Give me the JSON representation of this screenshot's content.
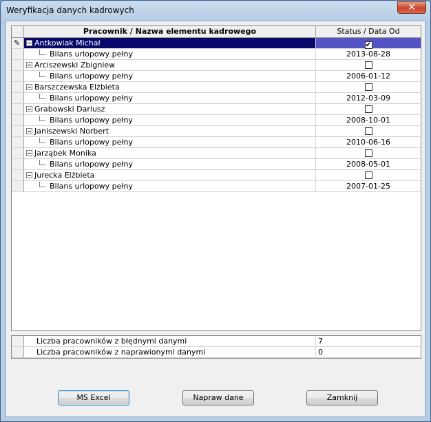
{
  "window": {
    "title": "Weryfikacja danych kadrowych",
    "close_glyph": "✕"
  },
  "grid": {
    "columns": [
      "Pracownik / Nazwa elementu kadrowego",
      "Status / Data Od"
    ],
    "rows": [
      {
        "employee": "Antkowiak Michał",
        "checked": true,
        "selected": true,
        "item": "Bilans urlopowy pełny",
        "date": "2013-08-28"
      },
      {
        "employee": "Arciszewski Zbigniew",
        "checked": false,
        "item": "Bilans urlopowy pełny",
        "date": "2006-01-12"
      },
      {
        "employee": "Barszczewska Elżbieta",
        "checked": false,
        "item": "Bilans urlopowy pełny",
        "date": "2012-03-09"
      },
      {
        "employee": "Grabowski Dariusz",
        "checked": false,
        "item": "Bilans urlopowy pełny",
        "date": "2008-10-01"
      },
      {
        "employee": "Janiszewski Norbert",
        "checked": false,
        "item": "Bilans urlopowy pełny",
        "date": "2010-06-16"
      },
      {
        "employee": "Jarząbek Monika",
        "checked": false,
        "item": "Bilans urlopowy pełny",
        "date": "2008-05-01"
      },
      {
        "employee": "Jurecka Elżbieta",
        "checked": false,
        "item": "Bilans urlopowy pełny",
        "date": "2007-01-25"
      }
    ],
    "check_glyph": "✔",
    "edit_indicator_glyph": "✎"
  },
  "summary": [
    {
      "label": "Liczba pracowników z błędnymi danymi",
      "value": "7"
    },
    {
      "label": "Liczba pracowników z naprawionymi danymi",
      "value": "0"
    }
  ],
  "buttons": {
    "excel": "MS Excel",
    "fix": "Napraw dane",
    "close": "Zamknij"
  },
  "icons": {
    "edit_row": "pencil-icon",
    "expander": "tree-collapse-icon",
    "close": "close-icon"
  }
}
